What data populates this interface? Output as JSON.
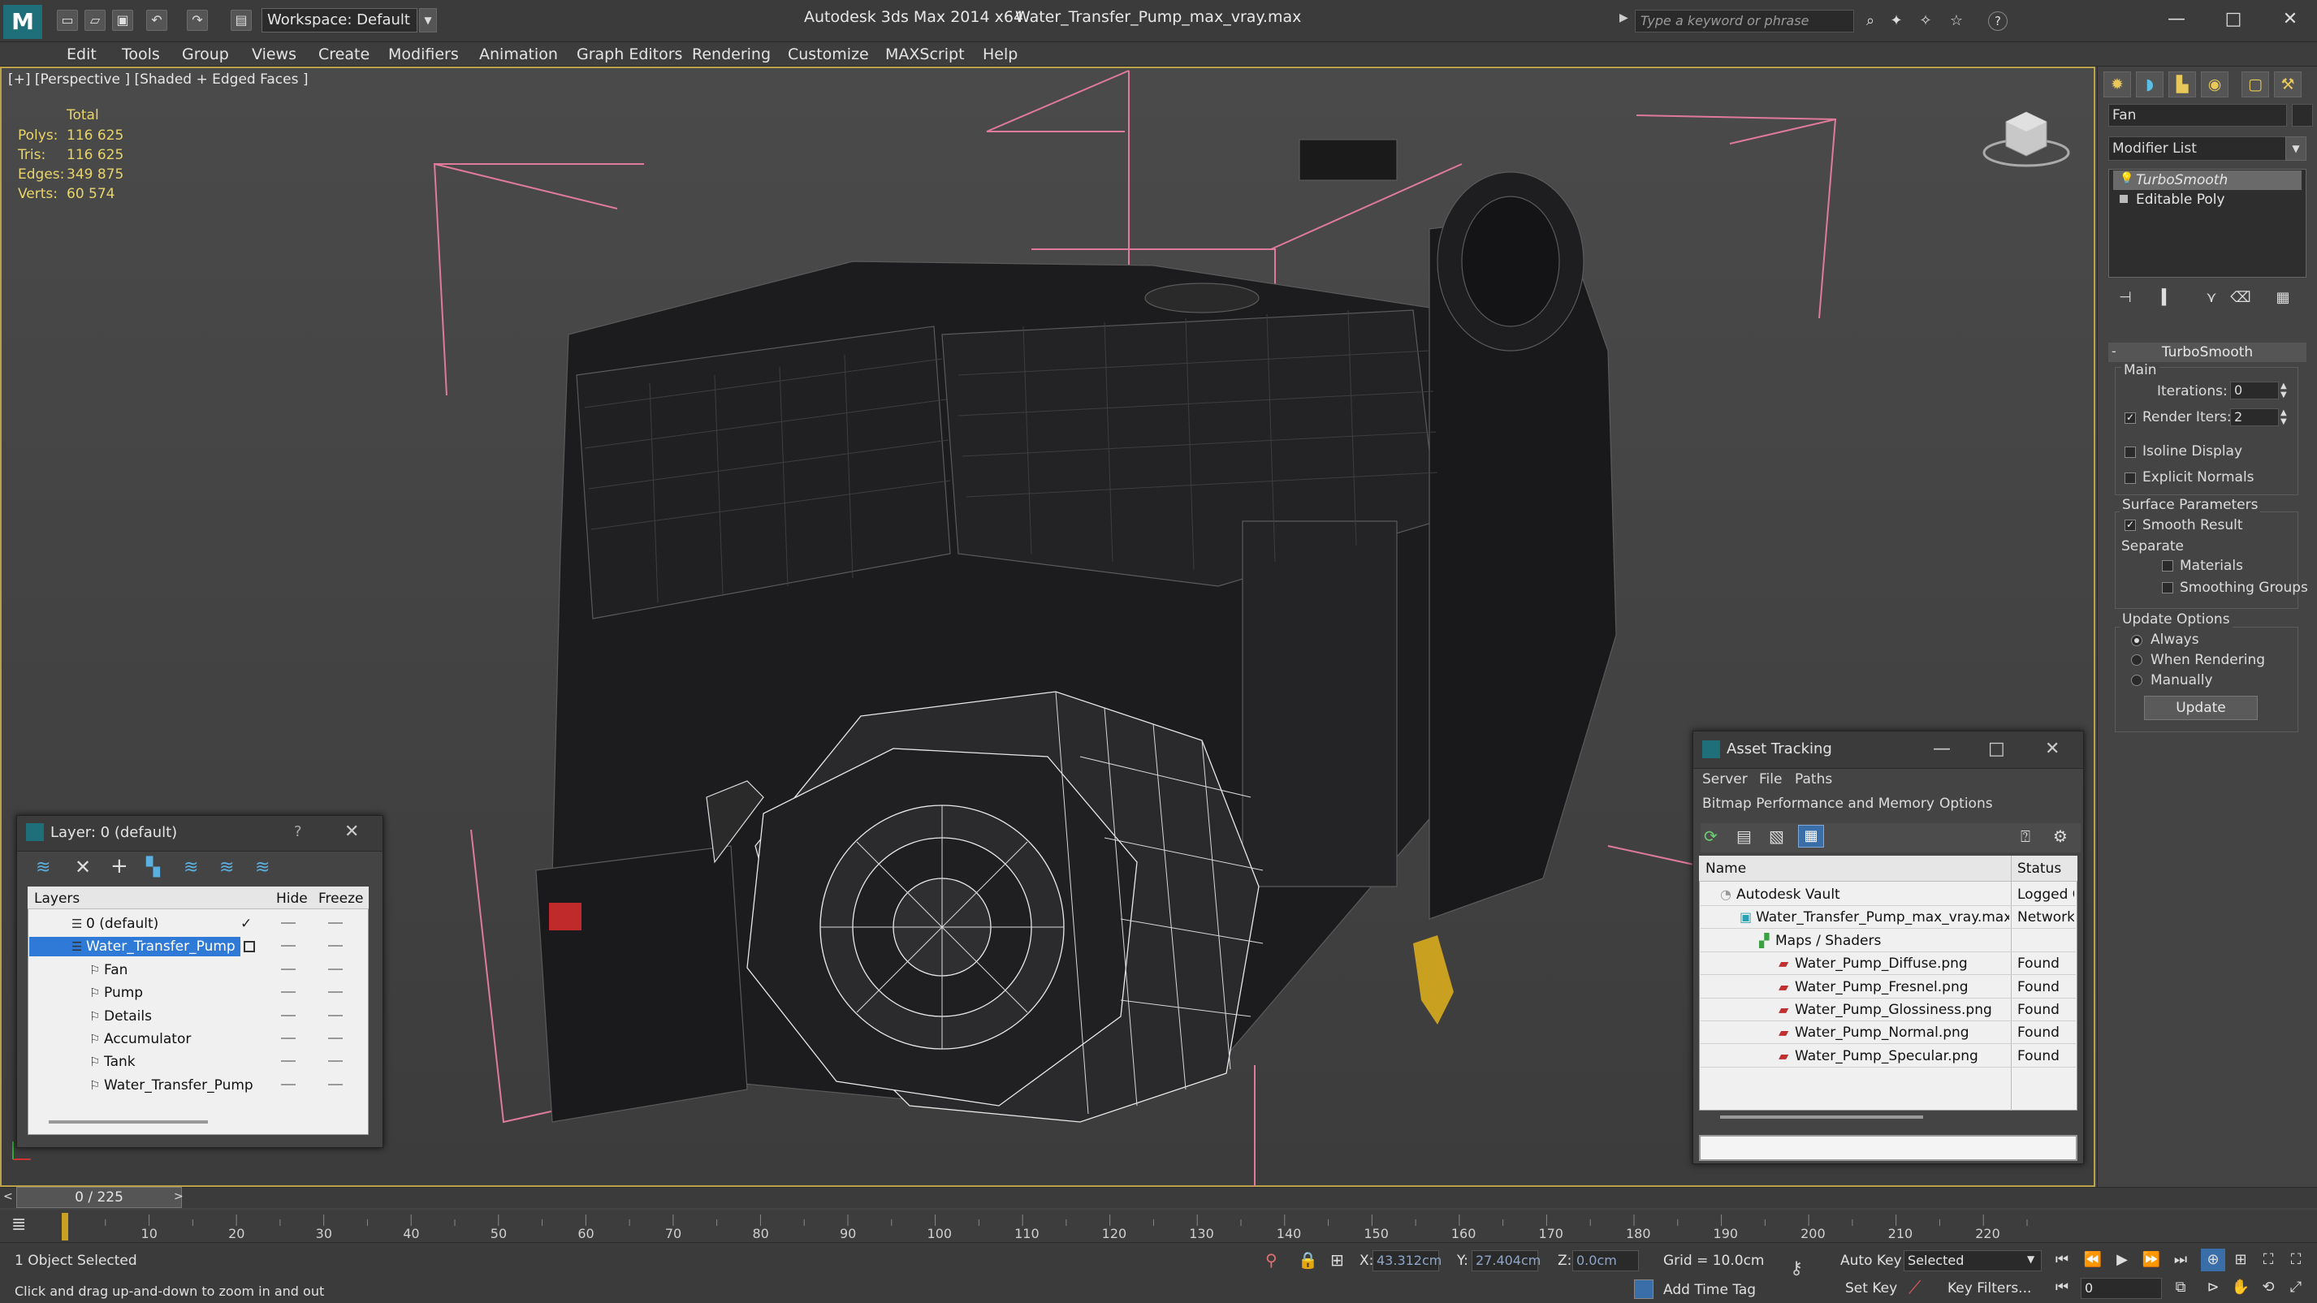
{
  "title_bar": {
    "app_title": "Autodesk 3ds Max  2014 x64",
    "file_title": "Water_Transfer_Pump_max_vray.max",
    "workspace": "Workspace: Default",
    "search_placeholder": "Type a keyword or phrase",
    "help_icon": "?"
  },
  "menu": [
    "Edit",
    "Tools",
    "Group",
    "Views",
    "Create",
    "Modifiers",
    "Animation",
    "Graph Editors",
    "Rendering",
    "Customize",
    "MAXScript",
    "Help"
  ],
  "viewport": {
    "label": "[+] [Perspective ] [Shaded + Edged Faces ]",
    "stats_header": "Total",
    "stats": [
      {
        "label": "Polys:",
        "value": "116 625"
      },
      {
        "label": "Tris:",
        "value": "116 625"
      },
      {
        "label": "Edges:",
        "value": "349 875"
      },
      {
        "label": "Verts:",
        "value": "60 574"
      }
    ]
  },
  "command_panel": {
    "object_name": "Fan",
    "modifier_list": "Modifier List",
    "stack": [
      {
        "label": "TurboSmooth",
        "active": true
      },
      {
        "label": "Editable Poly",
        "active": false
      }
    ],
    "rollout_title": "TurboSmooth",
    "main_label": "Main",
    "iterations_label": "Iterations:",
    "iterations_value": "0",
    "render_iters_label": "Render Iters:",
    "render_iters_value": "2",
    "isoline_label": "Isoline Display",
    "explicit_normals_label": "Explicit Normals",
    "surface_params_label": "Surface Parameters",
    "smooth_result_label": "Smooth Result",
    "separate_label": "Separate",
    "materials_label": "Materials",
    "smoothing_groups_label": "Smoothing Groups",
    "update_options_label": "Update Options",
    "always_label": "Always",
    "when_rendering_label": "When Rendering",
    "manually_label": "Manually",
    "update_button": "Update"
  },
  "layer_dialog": {
    "title": "Layer: 0 (default)",
    "help": "?",
    "columns": {
      "layers": "Layers",
      "hide": "Hide",
      "freeze": "Freeze"
    },
    "rows": [
      {
        "name": "0 (default)",
        "indent": 0,
        "selected": false,
        "current": true
      },
      {
        "name": "Water_Transfer_Pump",
        "indent": 0,
        "selected": true,
        "current": false
      },
      {
        "name": "Fan",
        "indent": 1,
        "selected": false,
        "current": false
      },
      {
        "name": "Pump",
        "indent": 1,
        "selected": false,
        "current": false
      },
      {
        "name": "Details",
        "indent": 1,
        "selected": false,
        "current": false
      },
      {
        "name": "Accumulator",
        "indent": 1,
        "selected": false,
        "current": false
      },
      {
        "name": "Tank",
        "indent": 1,
        "selected": false,
        "current": false
      },
      {
        "name": "Water_Transfer_Pump",
        "indent": 1,
        "selected": false,
        "current": false
      }
    ]
  },
  "asset_tracking": {
    "title": "Asset Tracking",
    "menu": [
      "Server",
      "File",
      "Paths"
    ],
    "menu2": [
      "Bitmap Performance and Memory",
      "Options"
    ],
    "columns": {
      "name": "Name",
      "status": "Status"
    },
    "rows": [
      {
        "name": "Autodesk Vault",
        "status": "Logged C",
        "indent": 1,
        "icon": "vault-icon"
      },
      {
        "name": "Water_Transfer_Pump_max_vray.max",
        "status": "Network",
        "indent": 2,
        "icon": "max-file-icon"
      },
      {
        "name": "Maps / Shaders",
        "status": "",
        "indent": 3,
        "icon": "maps-icon"
      },
      {
        "name": "Water_Pump_Diffuse.png",
        "status": "Found",
        "indent": 4,
        "icon": "png-icon"
      },
      {
        "name": "Water_Pump_Fresnel.png",
        "status": "Found",
        "indent": 4,
        "icon": "png-icon"
      },
      {
        "name": "Water_Pump_Glossiness.png",
        "status": "Found",
        "indent": 4,
        "icon": "png-icon"
      },
      {
        "name": "Water_Pump_Normal.png",
        "status": "Found",
        "indent": 4,
        "icon": "png-icon"
      },
      {
        "name": "Water_Pump_Specular.png",
        "status": "Found",
        "indent": 4,
        "icon": "png-icon"
      }
    ]
  },
  "timeline": {
    "slider": "0 / 225",
    "ticks": [
      "10",
      "20",
      "30",
      "40",
      "50",
      "60",
      "70",
      "80",
      "90",
      "100",
      "110",
      "120",
      "130",
      "140",
      "150",
      "160",
      "170",
      "180",
      "190",
      "200",
      "210",
      "220"
    ]
  },
  "status": {
    "selection": "1 Object Selected",
    "prompt": "Click and drag up-and-down to zoom in and out",
    "x_label": "X:",
    "x_value": "43.312cm",
    "y_label": "Y:",
    "y_value": "27.404cm",
    "z_label": "Z:",
    "z_value": "0.0cm",
    "grid": "Grid = 10.0cm",
    "auto_key": "Auto Key",
    "selected": "Selected",
    "set_key": "Set Key",
    "key_filters": "Key Filters...",
    "add_time_tag": "Add Time Tag",
    "frame": "0"
  }
}
